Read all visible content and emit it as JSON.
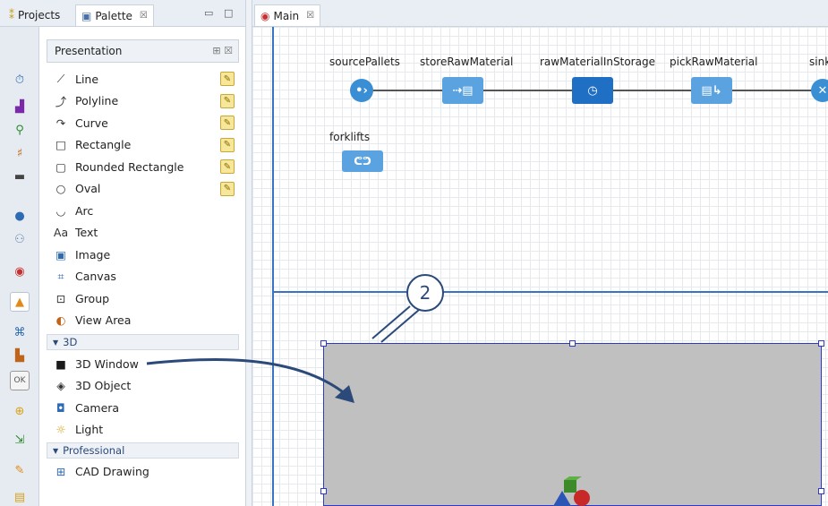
{
  "left_tabs": {
    "projects_label": "Projects",
    "palette_label": "Palette",
    "palette_close": "☒"
  },
  "palette": {
    "header_title": "Presentation",
    "items": [
      {
        "label": "Line",
        "icon": "line-icon",
        "pencil": true
      },
      {
        "label": "Polyline",
        "icon": "polyline-icon",
        "pencil": true
      },
      {
        "label": "Curve",
        "icon": "curve-icon",
        "pencil": true
      },
      {
        "label": "Rectangle",
        "icon": "rectangle-icon",
        "pencil": true
      },
      {
        "label": "Rounded Rectangle",
        "icon": "rounded-rectangle-icon",
        "pencil": true
      },
      {
        "label": "Oval",
        "icon": "oval-icon",
        "pencil": true
      },
      {
        "label": "Arc",
        "icon": "arc-icon",
        "pencil": false
      },
      {
        "label": "Text",
        "icon": "text-icon",
        "pencil": false
      },
      {
        "label": "Image",
        "icon": "image-icon",
        "pencil": false
      },
      {
        "label": "Canvas",
        "icon": "canvas-icon",
        "pencil": false
      },
      {
        "label": "Group",
        "icon": "group-icon",
        "pencil": false
      },
      {
        "label": "View Area",
        "icon": "view-area-icon",
        "pencil": false
      }
    ],
    "section_3d": "3D",
    "items_3d": [
      {
        "label": "3D Window",
        "icon": "3d-window-icon"
      },
      {
        "label": "3D Object",
        "icon": "3d-object-icon"
      },
      {
        "label": "Camera",
        "icon": "camera-icon"
      },
      {
        "label": "Light",
        "icon": "light-icon"
      }
    ],
    "section_professional": "Professional",
    "items_professional": [
      {
        "label": "CAD Drawing",
        "icon": "cad-drawing-icon"
      }
    ]
  },
  "editor": {
    "tab_label": "Main",
    "tab_close": "☒"
  },
  "flowchart": {
    "blocks": [
      {
        "label": "sourcePallets",
        "icon": "source-icon",
        "color": "#3a8fd4"
      },
      {
        "label": "storeRawMaterial",
        "icon": "store-icon",
        "color": "#5aa3e0"
      },
      {
        "label": "rawMaterialInStorage",
        "icon": "clock-icon",
        "color": "#1f6fc4"
      },
      {
        "label": "pickRawMaterial",
        "icon": "pick-icon",
        "color": "#5aa3e0"
      },
      {
        "label": "sink",
        "icon": "sink-icon",
        "color": "#3a8fd4"
      }
    ],
    "resource_label": "forklifts"
  },
  "callout_number": "2",
  "colors": {
    "accent_blue": "#3b73c4",
    "selection_border": "#2f39c8",
    "view3d_fill": "#c0c0c0"
  }
}
